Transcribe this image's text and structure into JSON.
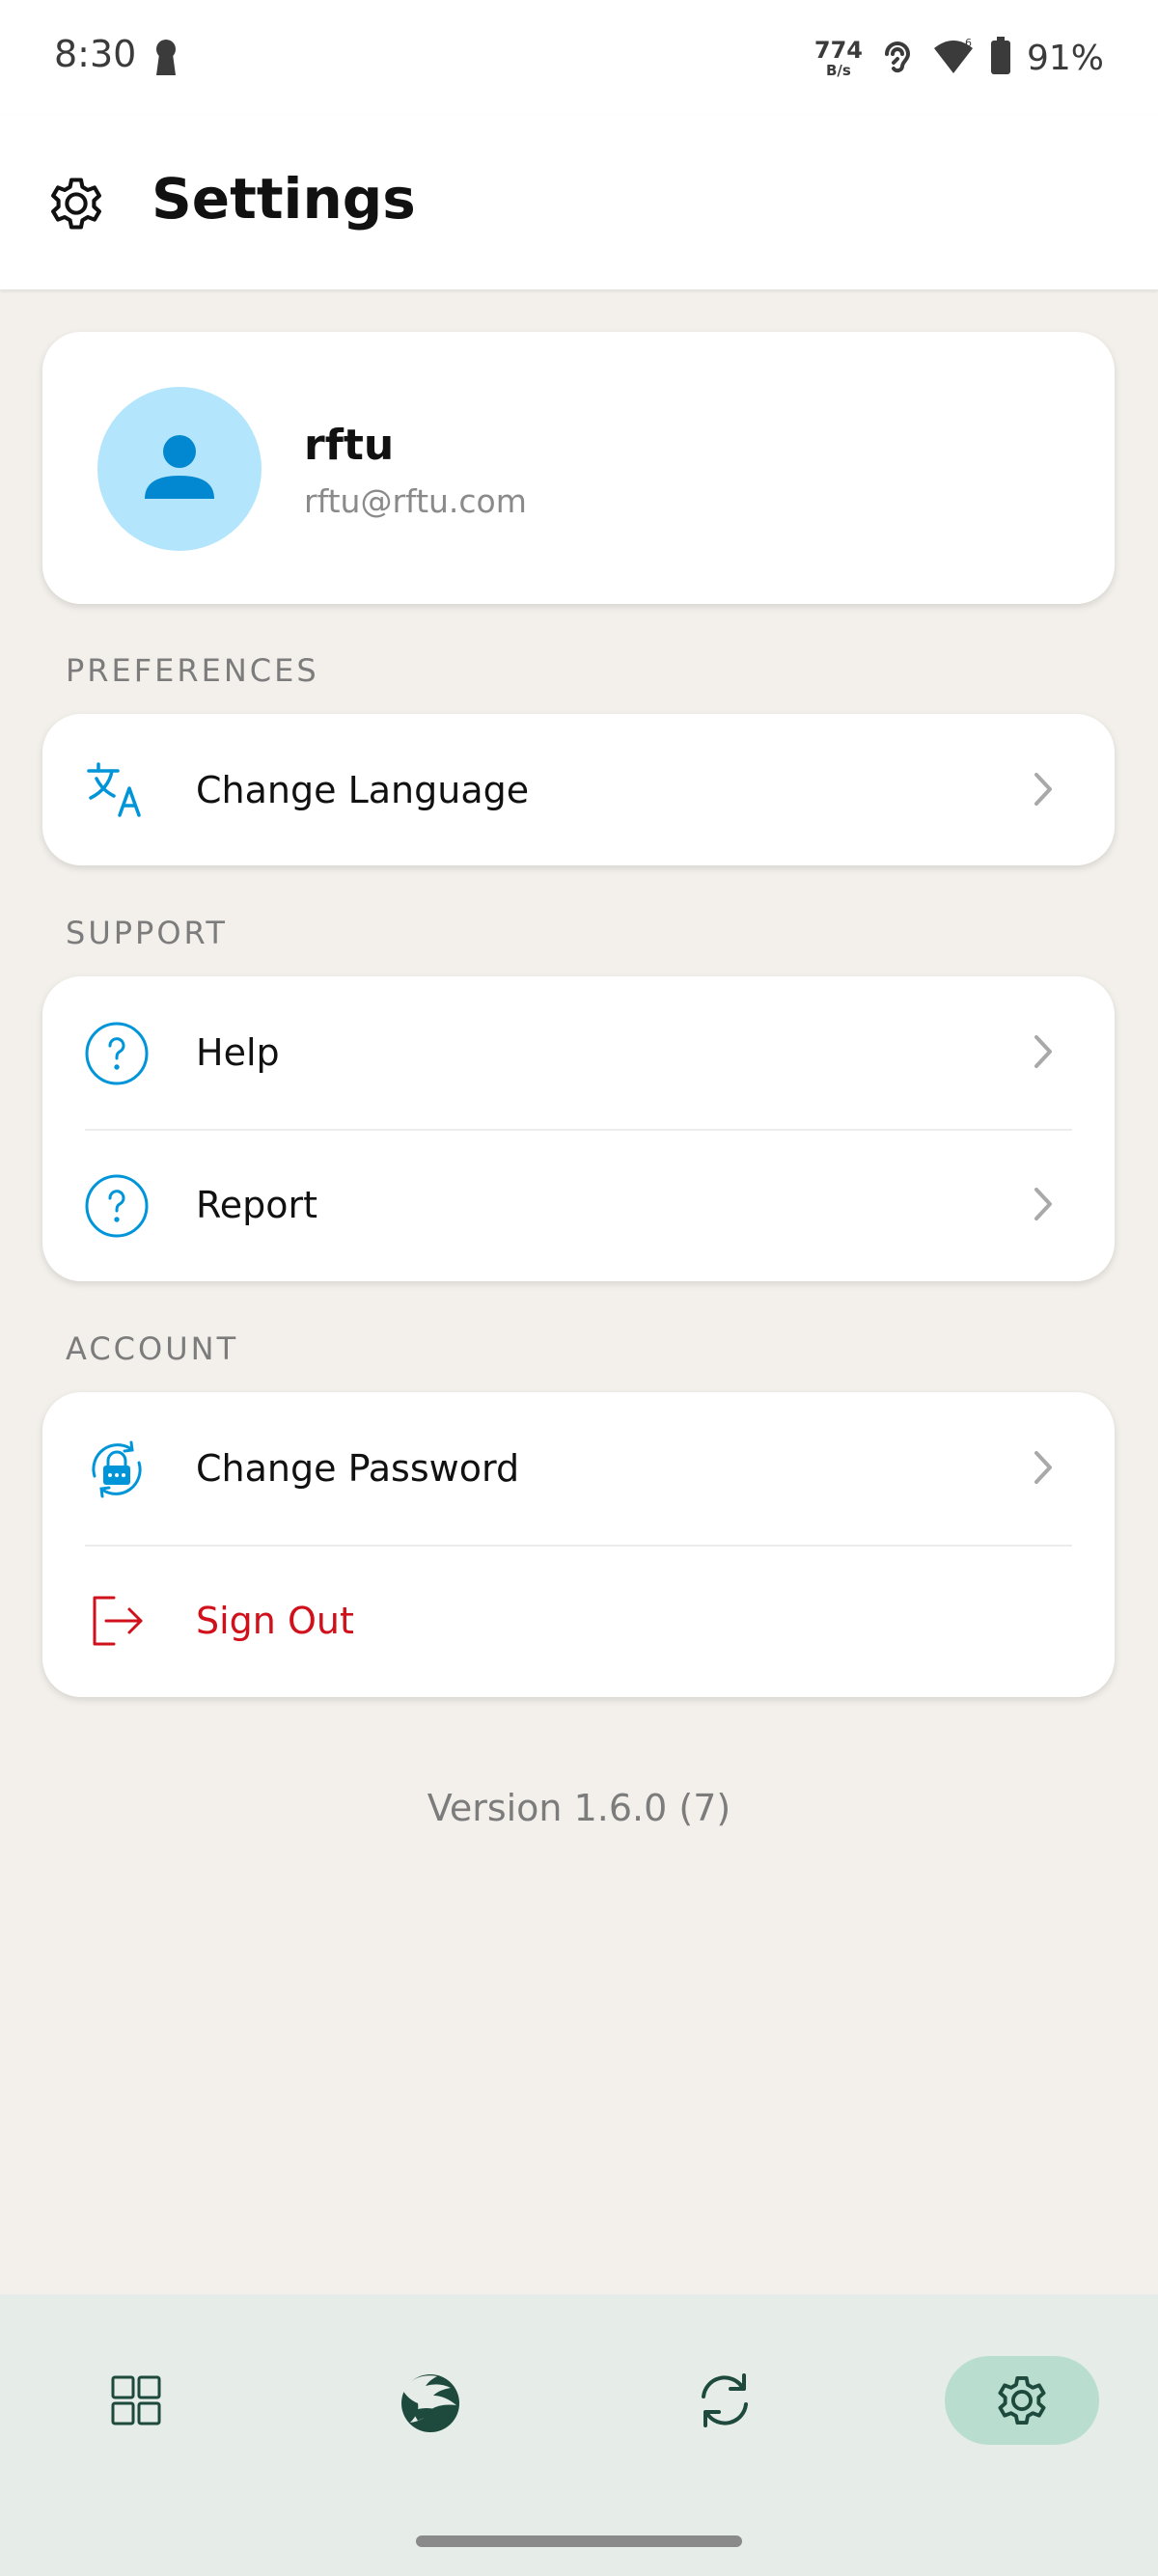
{
  "status_bar": {
    "time": "8:30",
    "net_speed_value": "774",
    "net_speed_unit": "B/s",
    "battery": "91%"
  },
  "app_bar": {
    "title": "Settings"
  },
  "profile": {
    "name": "rftu",
    "email": "rftu@rftu.com"
  },
  "sections": {
    "preferences": {
      "header": "PREFERENCES",
      "items": [
        {
          "label": "Change Language",
          "icon": "translate-icon"
        }
      ]
    },
    "support": {
      "header": "SUPPORT",
      "items": [
        {
          "label": "Help",
          "icon": "help-circle-icon"
        },
        {
          "label": "Report",
          "icon": "help-circle-icon"
        }
      ]
    },
    "account": {
      "header": "ACCOUNT",
      "items": [
        {
          "label": "Change Password",
          "icon": "password-lock-icon"
        },
        {
          "label": "Sign Out",
          "icon": "sign-out-icon"
        }
      ]
    }
  },
  "version": "Version 1.6.0 (7)",
  "bottom_nav": {
    "items": [
      {
        "name": "dashboard",
        "icon": "grid-icon",
        "active": false
      },
      {
        "name": "logo",
        "icon": "dragon-logo-icon",
        "active": false
      },
      {
        "name": "sync",
        "icon": "sync-icon",
        "active": false
      },
      {
        "name": "settings",
        "icon": "gear-icon",
        "active": true
      }
    ]
  },
  "colors": {
    "accent_blue": "#0095d9",
    "danger_red": "#d0111c",
    "background": "#f3f0eb",
    "nav_background": "#e6ece8",
    "nav_active": "#b9ded0",
    "nav_icon": "#1d4a3c"
  }
}
